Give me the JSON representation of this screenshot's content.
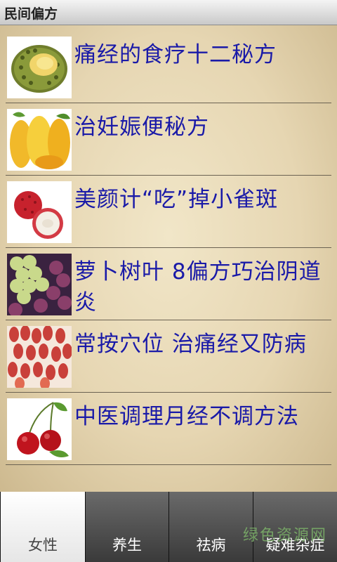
{
  "app": {
    "title": "民间偏方"
  },
  "articles": [
    {
      "title": "痛经的食疗十二秘方",
      "image": "durian-image"
    },
    {
      "title": "治妊娠便秘方",
      "image": "mango-image"
    },
    {
      "title": "美颜计“吃”掉小雀斑",
      "image": "lychee-image"
    },
    {
      "title": "萝卜树叶 8偏方巧治阴道炎",
      "image": "grapes-image"
    },
    {
      "title": "常按穴位 治痛经又防病",
      "image": "red-grapes-image"
    },
    {
      "title": "中医调理月经不调方法",
      "image": "cherry-image"
    }
  ],
  "tabs": [
    {
      "label": "女性",
      "active": true
    },
    {
      "label": "养生",
      "active": false
    },
    {
      "label": "祛病",
      "active": false
    },
    {
      "label": "疑难杂症",
      "active": false
    }
  ],
  "watermark": "绿色资源网"
}
